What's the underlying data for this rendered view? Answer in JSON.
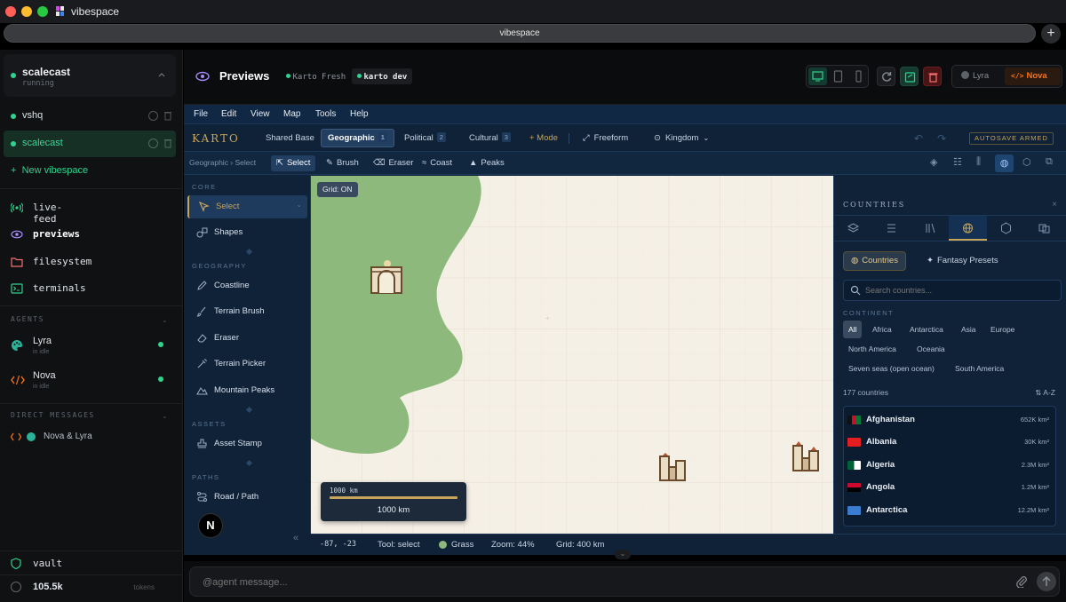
{
  "window": {
    "title": "vibespace",
    "url": "vibespace"
  },
  "sidebar": {
    "current_space": {
      "name": "scalecast",
      "status": "running"
    },
    "spaces": [
      {
        "name": "vshq"
      },
      {
        "name": "scalecast"
      }
    ],
    "new_space_label": "New vibespace",
    "nav": [
      {
        "label": "live-feed",
        "icon": "broadcast-icon"
      },
      {
        "label": "previews",
        "icon": "eye-icon"
      },
      {
        "label": "filesystem",
        "icon": "folder-icon"
      },
      {
        "label": "terminals",
        "icon": "terminal-icon"
      }
    ],
    "agents_heading": "AGENTS",
    "agents": [
      {
        "name": "Lyra",
        "sub": "in idle"
      },
      {
        "name": "Nova",
        "sub": "in idle"
      }
    ],
    "dm_heading": "DIRECT MESSAGES",
    "dm_item": "Nova & Lyra",
    "vault_label": "vault",
    "tokens_value": "105.5k",
    "tokens_label": "tokens"
  },
  "header": {
    "title": "Previews",
    "chips": [
      {
        "label": "Karto Fresh"
      },
      {
        "label": "karto dev"
      }
    ],
    "agents": [
      {
        "name": "Lyra"
      },
      {
        "name": "Nova"
      }
    ]
  },
  "karto": {
    "menu": [
      "File",
      "Edit",
      "View",
      "Map",
      "Tools",
      "Help"
    ],
    "logo": "KARTO",
    "modes": [
      {
        "label": "Shared Base",
        "badge": ""
      },
      {
        "label": "Geographic",
        "badge": "1"
      },
      {
        "label": "Political",
        "badge": "2"
      },
      {
        "label": "Cultural",
        "badge": "3"
      }
    ],
    "add_mode": "+ Mode",
    "freeform": "Freeform",
    "kingdom": "Kingdom",
    "autosave": "AUTOSAVE ARMED",
    "breadcrumb": "Geographic › Select",
    "tools2": [
      "Select",
      "Brush",
      "Eraser",
      "Coast",
      "Peaks"
    ],
    "panel": {
      "core": "CORE",
      "select": "Select",
      "shapes": "Shapes",
      "geography": "GEOGRAPHY",
      "geo_items": [
        "Coastline",
        "Terrain Brush",
        "Eraser",
        "Terrain Picker",
        "Mountain Peaks"
      ],
      "assets": "ASSETS",
      "asset_stamp": "Asset Stamp",
      "paths": "PATHS",
      "road_path": "Road / Path"
    },
    "map": {
      "grid_toggle": "Grid: ON",
      "scale_ruler": "1000 km",
      "scale_label": "1000 km"
    },
    "status": {
      "coords": "-87, -23",
      "tool": "Tool: select",
      "terrain": "Grass",
      "zoom": "Zoom: 44%",
      "grid": "Grid: 400 km"
    },
    "countries_panel": {
      "title": "COUNTRIES",
      "tab_countries": "Countries",
      "tab_presets": "Fantasy Presets",
      "search_placeholder": "Search countries...",
      "continent_label": "CONTINENT",
      "continents": [
        "All",
        "Africa",
        "Antarctica",
        "Asia",
        "Europe",
        "North America",
        "Oceania",
        "Seven seas (open ocean)",
        "South America"
      ],
      "count": "177 countries",
      "sort": "A-Z",
      "list": [
        {
          "name": "Afghanistan",
          "area": "652K km²"
        },
        {
          "name": "Albania",
          "area": "30K km²"
        },
        {
          "name": "Algeria",
          "area": "2.3M km²"
        },
        {
          "name": "Angola",
          "area": "1.2M km²"
        },
        {
          "name": "Antarctica",
          "area": "12.2M km²"
        }
      ]
    }
  },
  "chat": {
    "placeholder": "@agent message..."
  },
  "colors": {
    "accent": "#2fd38f",
    "karto_bg": "#0f2238",
    "map_bg": "#f5f0e6",
    "land": "#8dba7c",
    "gold": "#c9a45c"
  }
}
